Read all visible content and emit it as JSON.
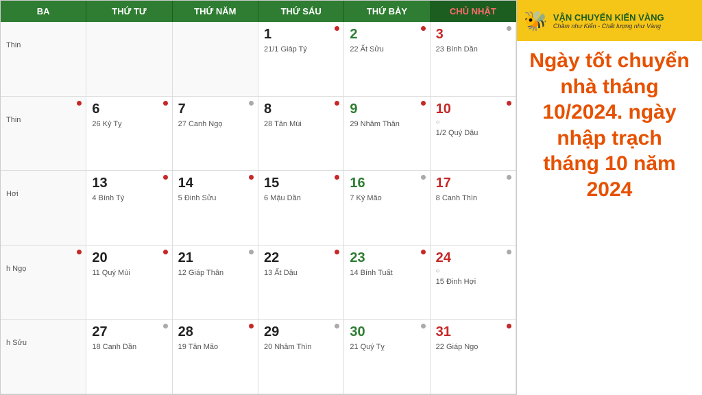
{
  "header": {
    "cols": [
      {
        "label": "BA",
        "red": false
      },
      {
        "label": "THỨ TƯ",
        "red": false
      },
      {
        "label": "THỨ NĂM",
        "red": false
      },
      {
        "label": "THỨ SÁU",
        "red": false
      },
      {
        "label": "THỨ BẢY",
        "red": false
      },
      {
        "label": "CHỦ NHẬT",
        "red": true
      }
    ]
  },
  "rows": [
    {
      "cells": [
        {
          "empty": true,
          "partial": "Thin"
        },
        {
          "empty": true
        },
        {
          "empty": true
        },
        {
          "day": "1",
          "color": "dark",
          "lunar": "21/1 Giáp Tý",
          "dot": "red"
        },
        {
          "day": "2",
          "color": "green",
          "lunar": "22 Ất Sửu",
          "dot": "red"
        },
        {
          "day": "3",
          "color": "red",
          "lunar": "23 Bính Dần",
          "dot": "gray"
        }
      ]
    },
    {
      "cells": [
        {
          "partial_dot": true,
          "partial": "Thin",
          "partial_lunar": ""
        },
        {
          "day": "6",
          "color": "dark",
          "lunar": "26 Kỷ Tỵ",
          "dot": "red"
        },
        {
          "day": "7",
          "color": "dark",
          "lunar": "27 Canh Ngọ",
          "dot": "gray"
        },
        {
          "day": "8",
          "color": "dark",
          "lunar": "28 Tân Mùi",
          "dot": "red"
        },
        {
          "day": "9",
          "color": "green",
          "lunar": "29 Nhâm Thân",
          "dot": "red"
        },
        {
          "day": "10",
          "color": "red",
          "lunar": "1/2 Quý Dậu",
          "dot": "red",
          "tag": "○"
        }
      ]
    },
    {
      "cells": [
        {
          "partial_dot": false,
          "partial": "Hơi",
          "partial_lunar": ""
        },
        {
          "day": "13",
          "color": "dark",
          "lunar": "4 Bính Tý",
          "dot": "red"
        },
        {
          "day": "14",
          "color": "dark",
          "lunar": "5 Đinh Sửu",
          "dot": "red"
        },
        {
          "day": "15",
          "color": "dark",
          "lunar": "6 Mậu Dần",
          "dot": "red"
        },
        {
          "day": "16",
          "color": "green",
          "lunar": "7 Kỷ Mão",
          "dot": "gray"
        },
        {
          "day": "17",
          "color": "red",
          "lunar": "8 Canh Thìn",
          "dot": "gray"
        }
      ]
    },
    {
      "cells": [
        {
          "partial_dot": true,
          "partial": "h Ngọ",
          "partial_lunar": ""
        },
        {
          "day": "20",
          "color": "dark",
          "lunar": "11 Quý Mùi",
          "dot": "red"
        },
        {
          "day": "21",
          "color": "dark",
          "lunar": "12 Giáp Thân",
          "dot": "gray"
        },
        {
          "day": "22",
          "color": "dark",
          "lunar": "13 Ất Dậu",
          "dot": "red"
        },
        {
          "day": "23",
          "color": "green",
          "lunar": "14 Bính Tuất",
          "dot": "red"
        },
        {
          "day": "24",
          "color": "red",
          "lunar": "15 Đinh Hợi",
          "dot": "gray",
          "tag": "○"
        }
      ]
    },
    {
      "cells": [
        {
          "partial_dot": false,
          "partial": "h Sửu",
          "partial_lunar": ""
        },
        {
          "day": "27",
          "color": "dark",
          "lunar": "18 Canh Dần",
          "dot": "gray"
        },
        {
          "day": "28",
          "color": "dark",
          "lunar": "19 Tân Mão",
          "dot": "red"
        },
        {
          "day": "29",
          "color": "dark",
          "lunar": "20 Nhâm Thìn",
          "dot": "gray"
        },
        {
          "day": "30",
          "color": "green",
          "lunar": "21 Quý Tỵ",
          "dot": "gray"
        },
        {
          "day": "31",
          "color": "red",
          "lunar": "22 Giáp Ngọ",
          "dot": "red"
        }
      ]
    }
  ],
  "sidebar": {
    "logo_icon": "🐝",
    "logo_title": "Vận Chuyển Kiến Vàng",
    "logo_subtitle": "Chăm như Kiến - Chất lượng như Vàng",
    "promo_text": "Ngày tốt chuyển nhà tháng 10/2024. ngày nhập trạch tháng 10 năm 2024"
  }
}
